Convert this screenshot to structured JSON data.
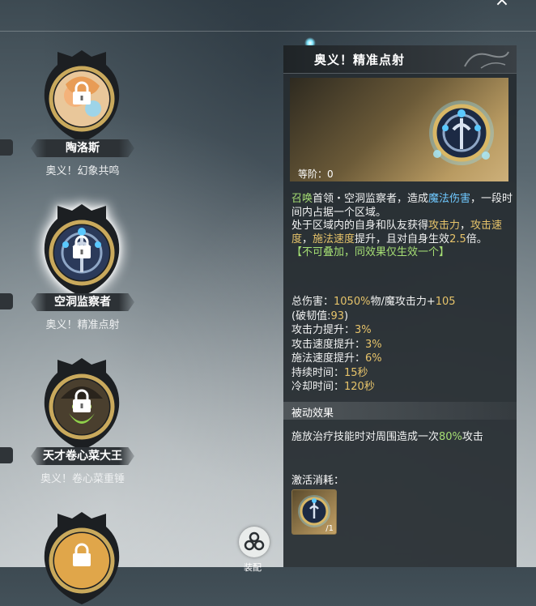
{
  "header": {
    "close_icon": "×"
  },
  "skills": [
    {
      "name": "陶洛斯",
      "subtitle": "奥义！幻象共鸣",
      "state": "locked"
    },
    {
      "name": "空洞监察者",
      "subtitle": "奥义！精准点射",
      "state": "locked-selected"
    },
    {
      "name": "天才卷心菜大王",
      "subtitle": "奥义！卷心菜重锤",
      "state": "locked"
    }
  ],
  "center_button": {
    "label": "装配"
  },
  "detail": {
    "title": "奥义！精准点射",
    "level_label": "等阶：0",
    "description": {
      "summon": "召唤",
      "t1": "首领・空洞监察者，造成",
      "damage_type": "魔法伤害",
      "t2": "，一段时间内占据一个区域。",
      "t3": "处于区域内的自身和队友获得",
      "buff1": "攻击力",
      "t4": "，",
      "buff2": "攻击速度",
      "t5": "，",
      "buff3": "施法速度",
      "t6": "提升，且对自身生效",
      "mult": "2.5",
      "t7": "倍。",
      "note": "【不可叠加，同效果仅生效一个】"
    },
    "stats": {
      "total_damage_label": "总伤害：",
      "total_damage_value": "1050%",
      "total_damage_suffix": "物/魔攻击力+",
      "total_damage_flat": "105",
      "break_label": "(破韧值:",
      "break_value": "93",
      "break_close": ")",
      "atk_label": "攻击力提升：",
      "atk_value": "3%",
      "atkspd_label": "攻击速度提升：",
      "atkspd_value": "3%",
      "castspd_label": "施法速度提升：",
      "castspd_value": "6%",
      "duration_label": "持续时间：",
      "duration_value": "15秒",
      "cooldown_label": "冷却时间：",
      "cooldown_value": "120秒"
    },
    "passive": {
      "title": "被动效果",
      "desc_pre": "施放治疗技能时对周围造成一次",
      "desc_value": "80%",
      "desc_post": "攻击"
    },
    "cost": {
      "label": "激活消耗：",
      "count": "/1"
    }
  },
  "colors": {
    "green": "#a6df74",
    "blue": "#6fc8ff",
    "gold": "#e6c36a"
  }
}
